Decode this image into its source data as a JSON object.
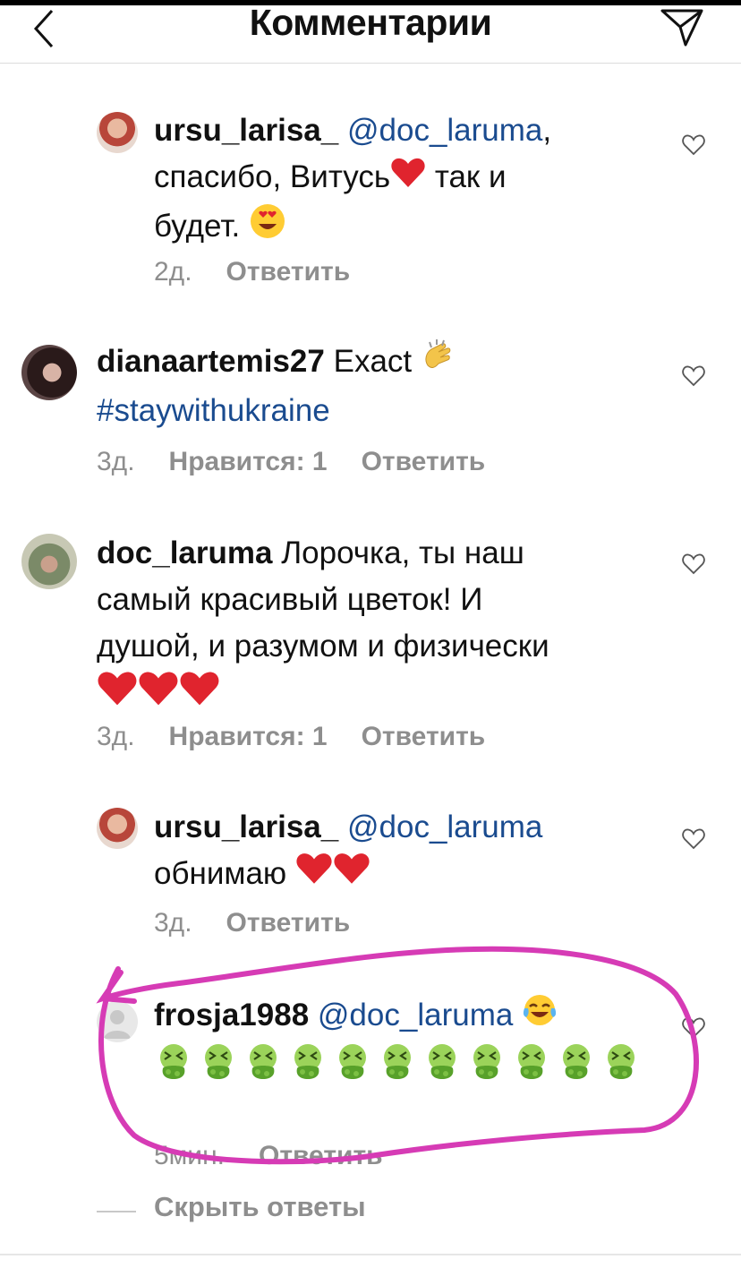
{
  "header": {
    "title": "Комментарии"
  },
  "comments": [
    {
      "username": "ursu_larisa_",
      "mention": "@doc_laruma",
      "lines": [
        ", ",
        "спасибо, Витусь",
        " так и",
        "будет. "
      ],
      "time": "2д.",
      "reply": "Ответить"
    },
    {
      "username": "dianaartemis27",
      "text_line1": " Exact ",
      "hashtag": "#staywithukraine",
      "time": "3д.",
      "likes": "Нравится: 1",
      "reply": "Ответить"
    },
    {
      "username": "doc_laruma",
      "text_line1": " Лорочка, ты наш",
      "text_line2": "самый красивый цветок! И",
      "text_line3": "душой, и разумом и физически",
      "time": "3д.",
      "likes": "Нравится: 1",
      "reply": "Ответить"
    },
    {
      "username": "ursu_larisa_",
      "mention": "@doc_laruma",
      "text_line2": "обнимаю ",
      "time": "3д.",
      "reply": "Ответить"
    },
    {
      "username": "frosja1988",
      "mention": "@doc_laruma",
      "time": "5мин.",
      "reply": "Ответить"
    }
  ],
  "hide_replies": "Скрыть ответы",
  "colors": {
    "mention": "#1a4b8f",
    "annotation": "#d63bb5",
    "meta": "#8e8e8e"
  }
}
